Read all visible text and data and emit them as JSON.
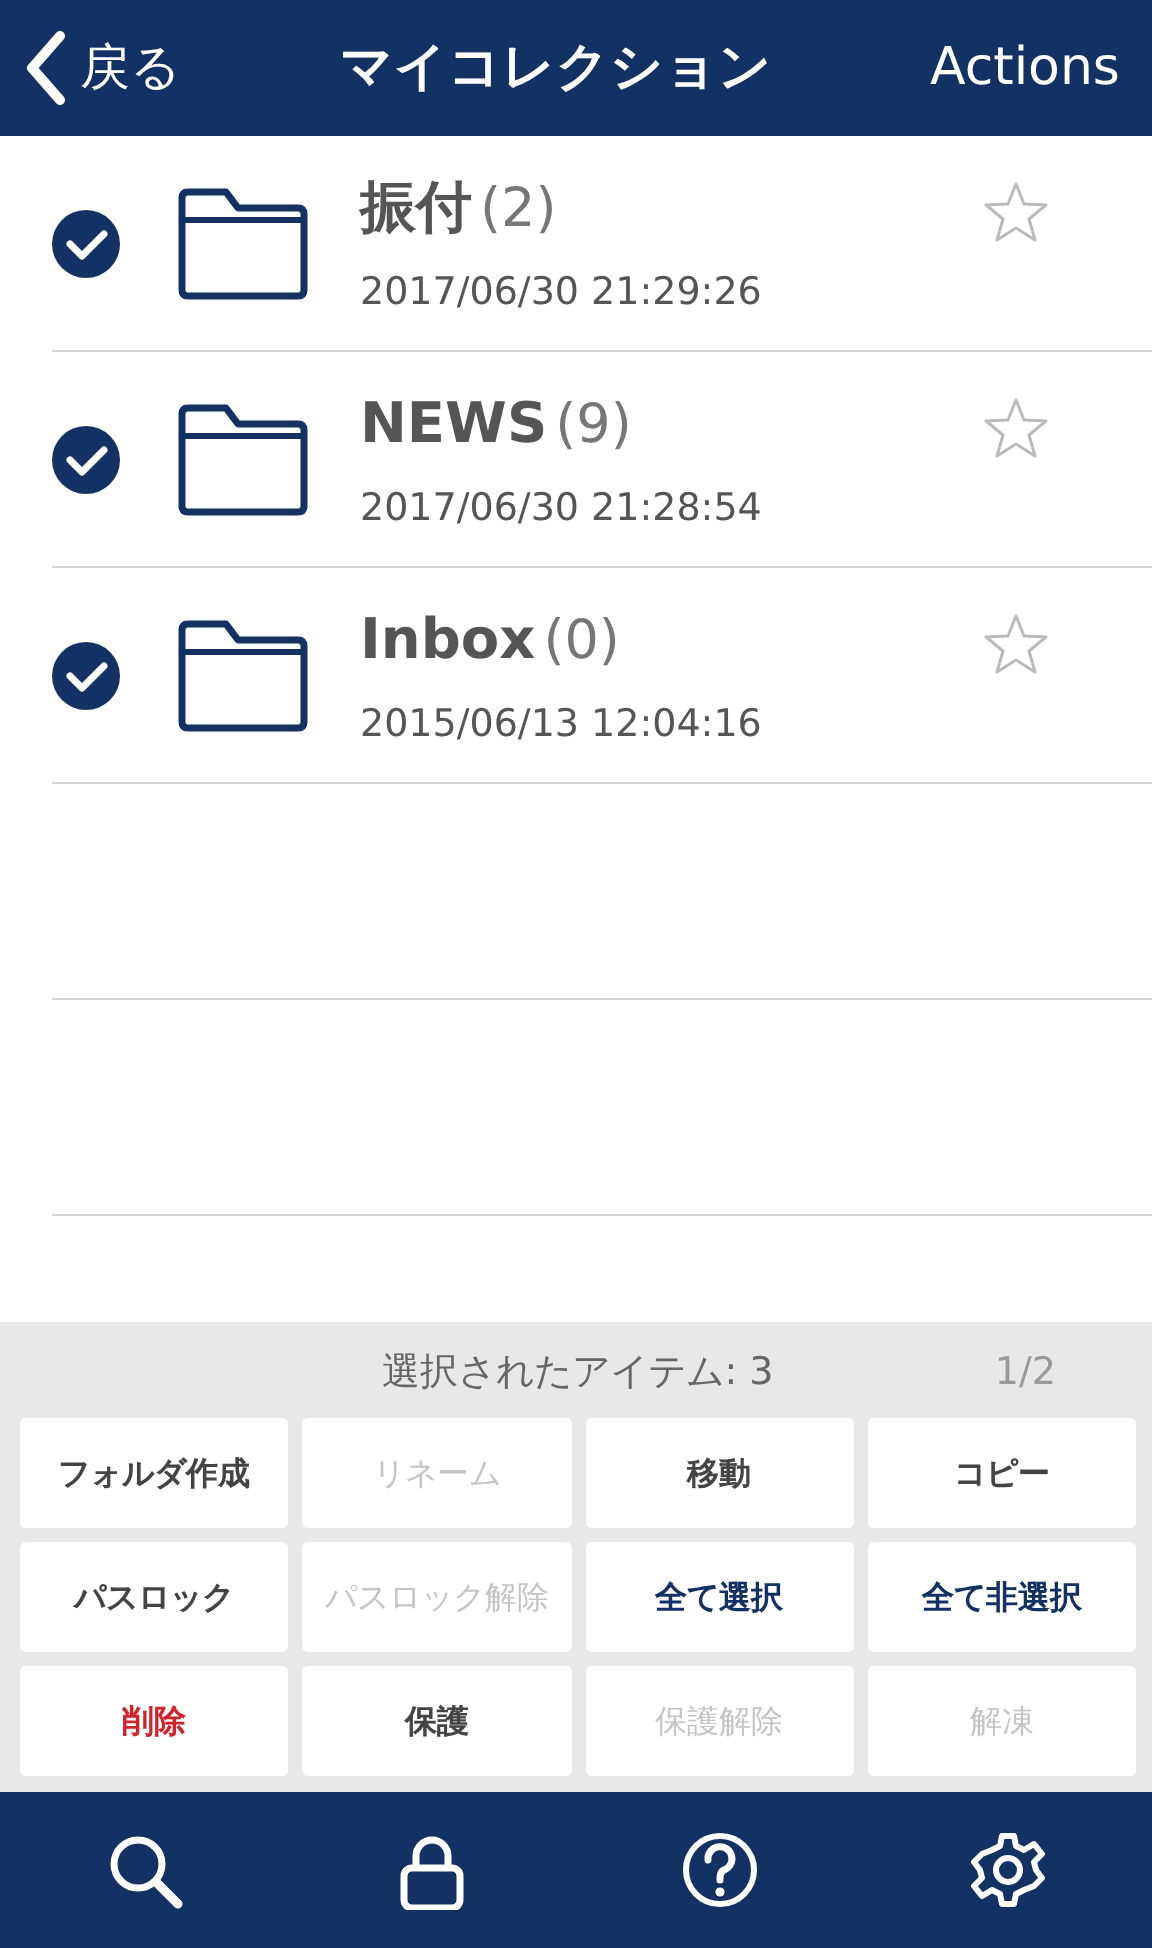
{
  "navbar": {
    "back": "戻る",
    "title": "マイコレクション",
    "action": "Actions"
  },
  "items": [
    {
      "name": "振付",
      "count": "(2)",
      "date": "2017/06/30 21:29:26",
      "checked": true,
      "starred": false
    },
    {
      "name": "NEWS",
      "count": "(9)",
      "date": "2017/06/30 21:28:54",
      "checked": true,
      "starred": false
    },
    {
      "name": "Inbox",
      "count": "(0)",
      "date": "2015/06/13 12:04:16",
      "checked": true,
      "starred": false
    }
  ],
  "panel": {
    "selection": "選択されたアイテム: 3",
    "page": "1/2",
    "buttons": [
      {
        "label": "フォルダ作成",
        "kind": "normal"
      },
      {
        "label": "リネーム",
        "kind": "disabled"
      },
      {
        "label": "移動",
        "kind": "normal"
      },
      {
        "label": "コピー",
        "kind": "normal"
      },
      {
        "label": "パスロック",
        "kind": "normal"
      },
      {
        "label": "パスロック解除",
        "kind": "disabled"
      },
      {
        "label": "全て選択",
        "kind": "primary"
      },
      {
        "label": "全て非選択",
        "kind": "primary"
      },
      {
        "label": "削除",
        "kind": "danger"
      },
      {
        "label": "保護",
        "kind": "normal"
      },
      {
        "label": "保護解除",
        "kind": "disabled"
      },
      {
        "label": "解凍",
        "kind": "disabled"
      }
    ]
  },
  "tabbar": [
    {
      "kind": "search"
    },
    {
      "kind": "lock"
    },
    {
      "kind": "help"
    },
    {
      "kind": "settings"
    }
  ]
}
